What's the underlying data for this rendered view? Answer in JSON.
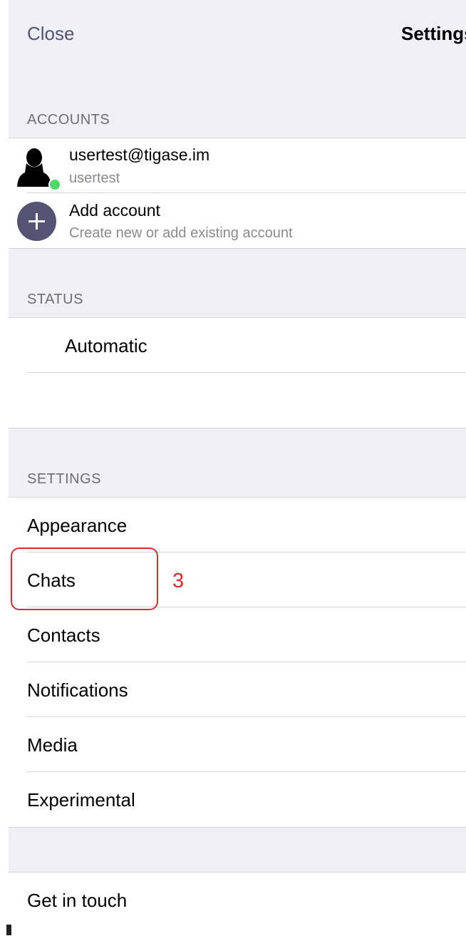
{
  "nav": {
    "close_label": "Close",
    "title": "Settings"
  },
  "accounts": {
    "header": "ACCOUNTS",
    "items": [
      {
        "name": "usertest@tigase.im",
        "subtitle": "usertest",
        "status": "online"
      }
    ],
    "add": {
      "label": "Add account",
      "subtitle": "Create new or add existing account"
    }
  },
  "status": {
    "header": "STATUS",
    "value": "Automatic"
  },
  "settings": {
    "header": "SETTINGS",
    "items": [
      {
        "label": "Appearance"
      },
      {
        "label": "Chats"
      },
      {
        "label": "Contacts"
      },
      {
        "label": "Notifications"
      },
      {
        "label": "Media"
      },
      {
        "label": "Experimental"
      }
    ]
  },
  "support": {
    "items": [
      {
        "label": "Get in touch"
      }
    ]
  },
  "annotation": {
    "label": "3",
    "target": "Chats"
  },
  "colors": {
    "accent": "#555373",
    "online": "#4cd964",
    "annotation": "#e0282e",
    "background": "#f0eff5"
  }
}
